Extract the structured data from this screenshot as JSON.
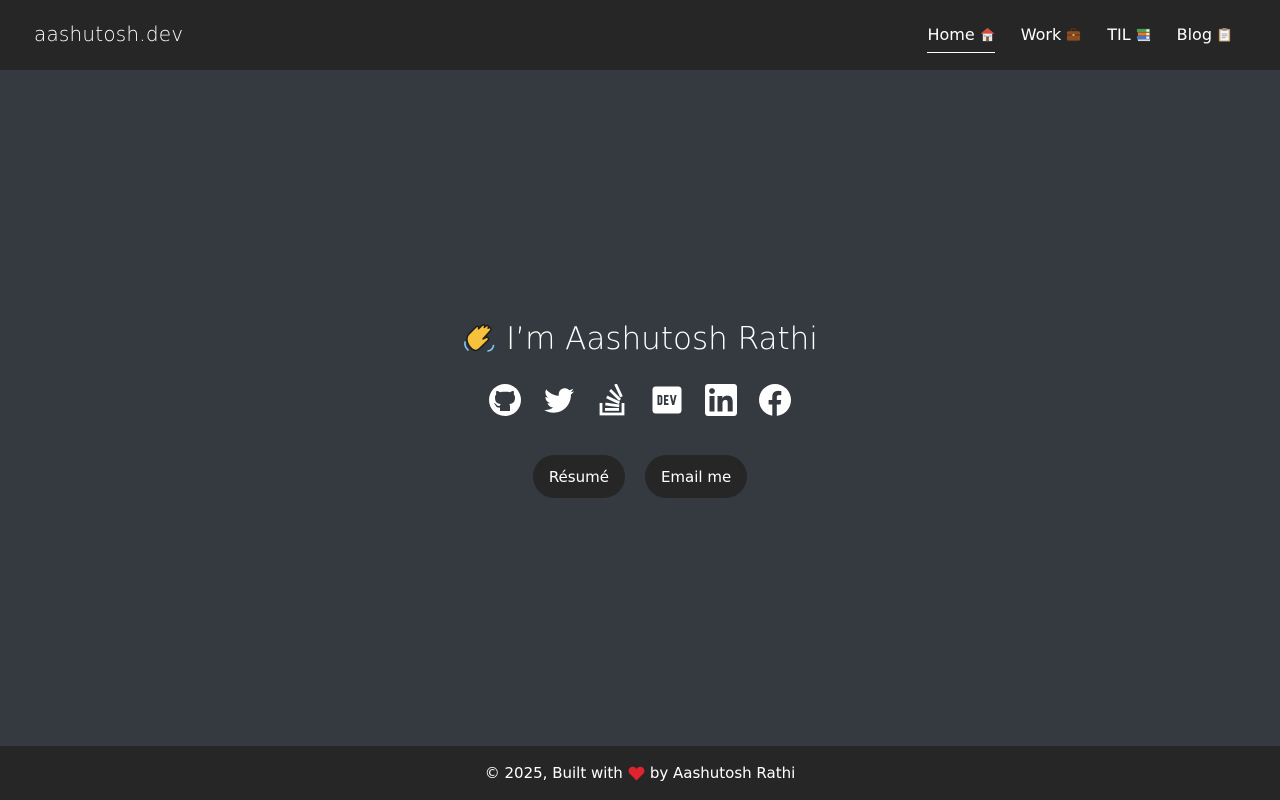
{
  "header": {
    "brand": "aashutosh.dev",
    "nav": [
      {
        "label": "Home",
        "icon": "house-icon",
        "active": true
      },
      {
        "label": "Work",
        "icon": "briefcase-icon",
        "active": false
      },
      {
        "label": "TIL",
        "icon": "books-icon",
        "active": false
      },
      {
        "label": "Blog",
        "icon": "clipboard-icon",
        "active": false
      }
    ]
  },
  "hero": {
    "title": "I’m Aashutosh Rathi",
    "title_icon": "waving-hand-icon",
    "socials": [
      {
        "icon": "github-icon"
      },
      {
        "icon": "twitter-icon"
      },
      {
        "icon": "stackoverflow-icon"
      },
      {
        "icon": "dev-icon"
      },
      {
        "icon": "linkedin-icon"
      },
      {
        "icon": "facebook-icon"
      }
    ],
    "buttons": {
      "resume": "Résumé",
      "email": "Email me"
    }
  },
  "footer": {
    "prefix": "© 2025, Built with",
    "heart_icon": "heart-icon",
    "suffix": "by Aashutosh Rathi"
  },
  "colors": {
    "background": "#343a3f",
    "bar": "#262626",
    "text": "#ffffff",
    "heart": "#e0242e"
  }
}
